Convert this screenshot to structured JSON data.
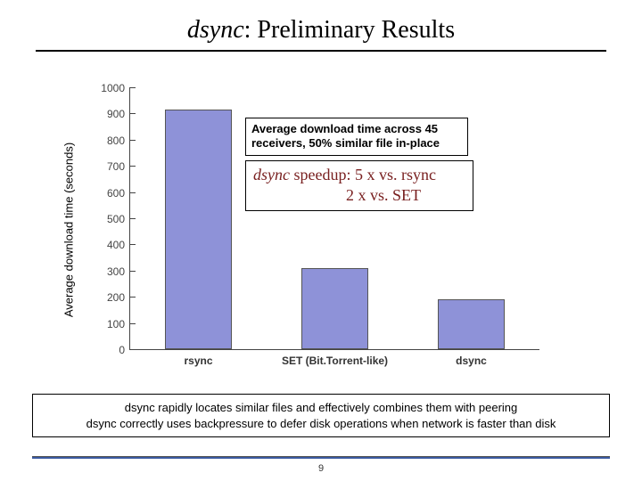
{
  "title_em": "dsync",
  "title_rest": ": Preliminary Results",
  "chart_data": {
    "type": "bar",
    "categories": [
      "rsync",
      "SET (Bit.Torrent-like)",
      "dsync"
    ],
    "values": [
      915,
      310,
      190
    ],
    "title": "",
    "xlabel": "",
    "ylabel": "Average download time (seconds)",
    "ylim": [
      0,
      1000
    ],
    "yticks": [
      0,
      100,
      200,
      300,
      400,
      500,
      600,
      700,
      800,
      900,
      1000
    ]
  },
  "annotation": {
    "line1": "Average download time across 45",
    "line2": "receivers, 50% similar file in-place"
  },
  "speedup": {
    "em": "dsync",
    "line1_rest": " speedup: 5 x vs. rsync",
    "line2": "2 x vs. SET"
  },
  "footer": {
    "line1": "dsync rapidly locates similar files and effectively combines them with peering",
    "line2": "dsync correctly uses backpressure to defer disk operations when network is faster than disk"
  },
  "page_number": "9"
}
